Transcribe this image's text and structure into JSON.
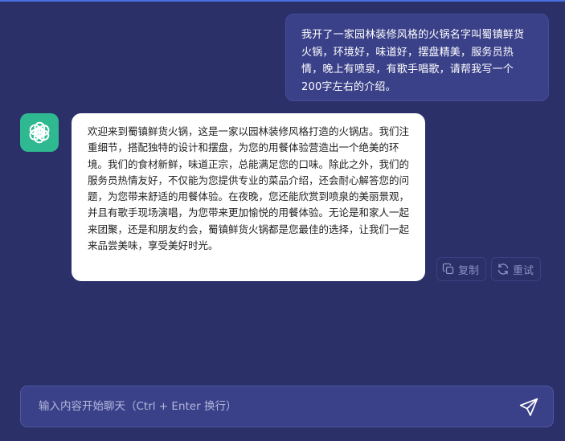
{
  "conversation": {
    "user_message": "我开了一家园林装修风格的火锅名字叫蜀镇鲜货火锅，环境好，味道好，摆盘精美，服务员热情，晚上有喷泉，有歌手唱歌，请帮我写一个200字左右的介绍。",
    "bot_message": "欢迎来到蜀镇鲜货火锅，这是一家以园林装修风格打造的火锅店。我们注重细节，搭配独特的设计和摆盘，为您的用餐体验营造出一个绝美的环境。我们的食材新鲜，味道正宗，总能满足您的口味。除此之外，我们的服务员热情友好，不仅能为您提供专业的菜品介绍，还会耐心解答您的问题，为您带来舒适的用餐体验。在夜晚，您还能欣赏到喷泉的美丽景观，并且有歌手现场演唱，为您带来更加愉悦的用餐体验。无论是和家人一起来团聚，还是和朋友约会，蜀镇鲜货火锅都是您最佳的选择，让我们一起来品尝美味，享受美好时光。",
    "bot_avatar_icon": "openai-logo-icon"
  },
  "actions": {
    "copy_label": "复制",
    "retry_label": "重试"
  },
  "composer": {
    "placeholder": "输入内容开始聊天（Ctrl + Enter 换行）",
    "value": "",
    "send_icon": "send-icon"
  },
  "colors": {
    "background": "#2b3068",
    "user_bubble": "#3b4189",
    "bot_bubble": "#ffffff",
    "avatar": "#2fb990",
    "accent": "#4a6fe0"
  }
}
